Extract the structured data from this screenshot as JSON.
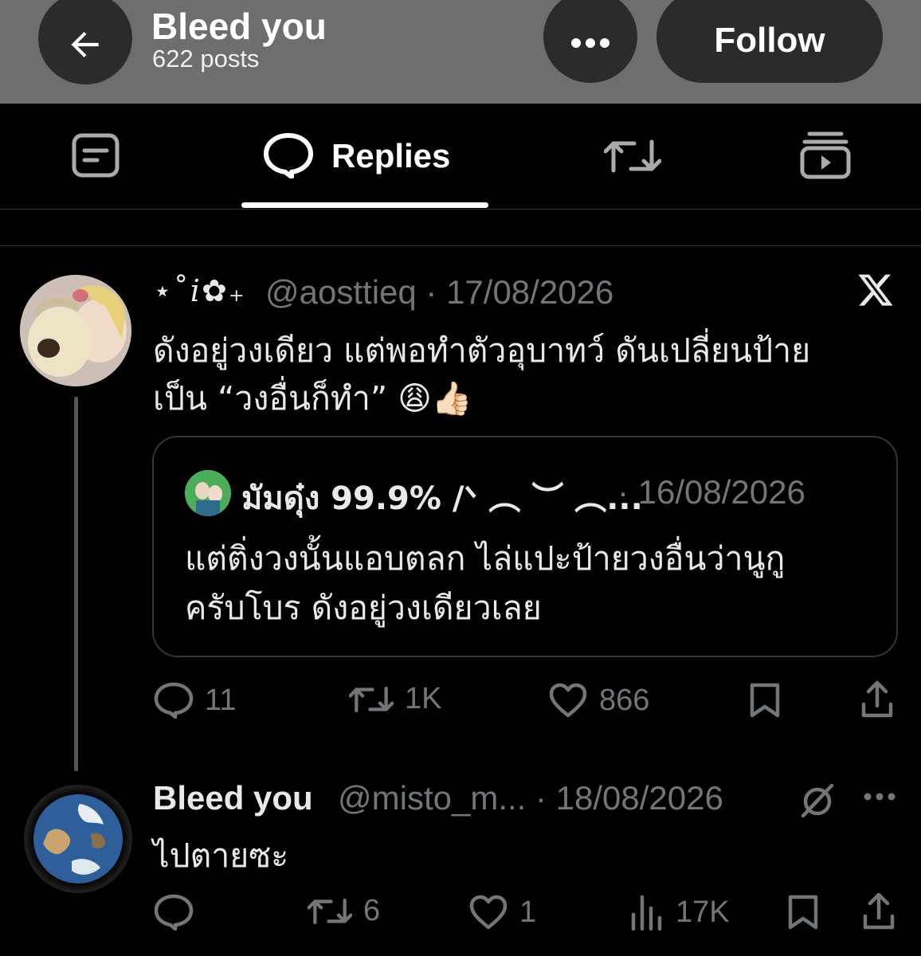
{
  "header": {
    "title": "Bleed you",
    "posts_count": "622 posts",
    "follow_label": "Follow"
  },
  "tabs": {
    "active_label": "Replies"
  },
  "tweet": {
    "display_name": "⋆˚𝑖✿₊",
    "handle_date": "@aosttieq · 17/08/2026",
    "text_line1": "ดังอยู่วงเดียว แต่พอทำตัวอุบาทว์ ดันเปลี่ยนป้าย",
    "text_line2": "เป็น “วงอื่นก็ทำ” 😩👍🏻",
    "quote": {
      "display_name": "มัมดุ๋ง 99.9% /ᐠ ︵ ︶ ︵...",
      "date": "· 16/08/2026",
      "text_line1": "แต่ติ่งวงนั้นแอบตลก ไล่แปะป้ายวงอื่นว่านูกู",
      "text_line2": "ครับโบร ดังอยู่วงเดียวเลย"
    },
    "replies": "11",
    "reposts": "1K",
    "likes": "866"
  },
  "reply": {
    "display_name": "Bleed you",
    "handle_date": "@misto_m... · 18/08/2026",
    "text": "ไปตายซะ",
    "reposts": "6",
    "likes": "1",
    "views": "17K"
  },
  "colors": {
    "header_bg": "#6e6e6e",
    "muted": "#71767b",
    "text": "#e7e9ea"
  }
}
